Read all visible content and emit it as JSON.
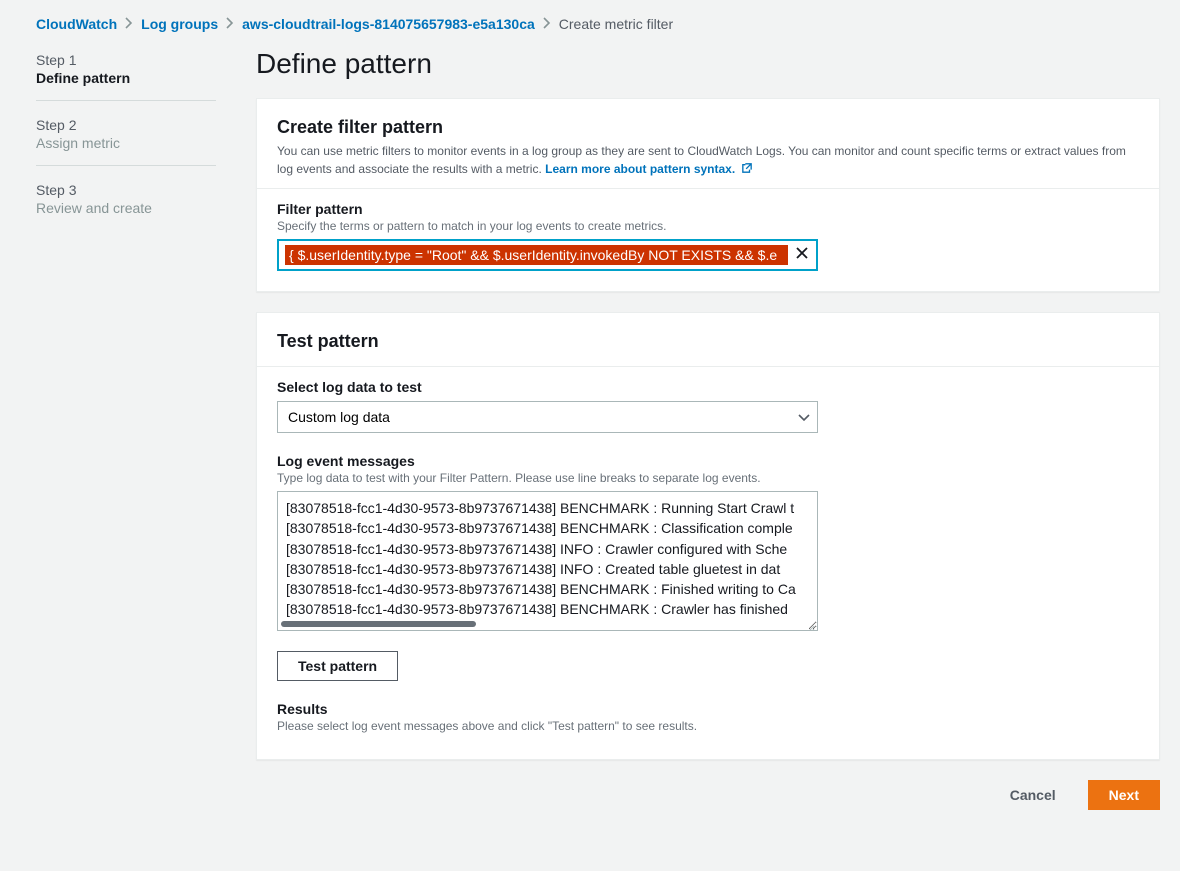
{
  "breadcrumb": {
    "items": [
      {
        "label": "CloudWatch"
      },
      {
        "label": "Log groups"
      },
      {
        "label": "aws-cloudtrail-logs-814075657983-e5a130ca"
      }
    ],
    "current": "Create metric filter"
  },
  "sidebar": {
    "steps": [
      {
        "num": "Step 1",
        "title": "Define pattern",
        "active": true
      },
      {
        "num": "Step 2",
        "title": "Assign metric",
        "active": false
      },
      {
        "num": "Step 3",
        "title": "Review and create",
        "active": false
      }
    ]
  },
  "page": {
    "title": "Define pattern"
  },
  "create_panel": {
    "title": "Create filter pattern",
    "desc": "You can use metric filters to monitor events in a log group as they are sent to CloudWatch Logs. You can monitor and count specific terms or extract values from log events and associate the results with a metric.",
    "learn_more": "Learn more about pattern syntax.",
    "filter_label": "Filter pattern",
    "filter_hint": "Specify the terms or pattern to match in your log events to create metrics.",
    "filter_value": "{ $.userIdentity.type = \"Root\" && $.userIdentity.invokedBy NOT EXISTS && $.e"
  },
  "test_panel": {
    "title": "Test pattern",
    "select_label": "Select log data to test",
    "select_value": "Custom log data",
    "log_label": "Log event messages",
    "log_hint": "Type log data to test with your Filter Pattern. Please use line breaks to separate log events.",
    "log_lines": [
      "[83078518-fcc1-4d30-9573-8b9737671438] BENCHMARK : Running Start Crawl t",
      "[83078518-fcc1-4d30-9573-8b9737671438] BENCHMARK : Classification comple",
      "[83078518-fcc1-4d30-9573-8b9737671438] INFO : Crawler configured with Sche",
      "[83078518-fcc1-4d30-9573-8b9737671438] INFO : Created table gluetest in dat",
      "[83078518-fcc1-4d30-9573-8b9737671438] BENCHMARK : Finished writing to Ca",
      "[83078518-fcc1-4d30-9573-8b9737671438] BENCHMARK : Crawler has finished "
    ],
    "test_button": "Test pattern",
    "results_label": "Results",
    "results_hint": "Please select log event messages above and click \"Test pattern\" to see results."
  },
  "footer": {
    "cancel": "Cancel",
    "next": "Next"
  }
}
